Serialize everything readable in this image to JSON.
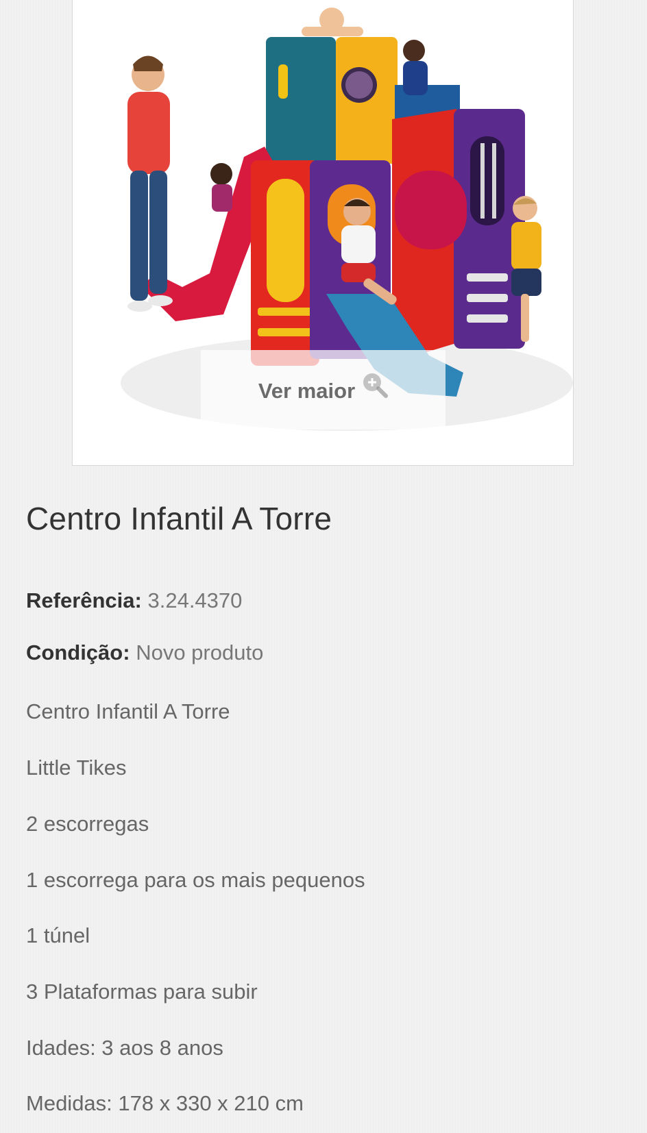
{
  "product": {
    "image_alt": "Centro Infantil A Torre",
    "zoom_label": "Ver maior",
    "title": "Centro Infantil A Torre",
    "reference_label": "Referência:",
    "reference_value": "3.24.4370",
    "condition_label": "Condição:",
    "condition_value": "Novo produto",
    "description": [
      "Centro Infantil A Torre",
      "Little Tikes",
      "2 escorregas",
      "1 escorrega para os mais pequenos",
      "1 túnel",
      "3 Plataformas para subir",
      "Idades: 3 aos 8 anos",
      "Medidas: 178 x 330 x 210 cm"
    ]
  },
  "icons": {
    "zoom": "zoom-in-icon"
  },
  "colors": {
    "background": "#f1f1f1",
    "title": "#333333",
    "text": "#666666"
  }
}
